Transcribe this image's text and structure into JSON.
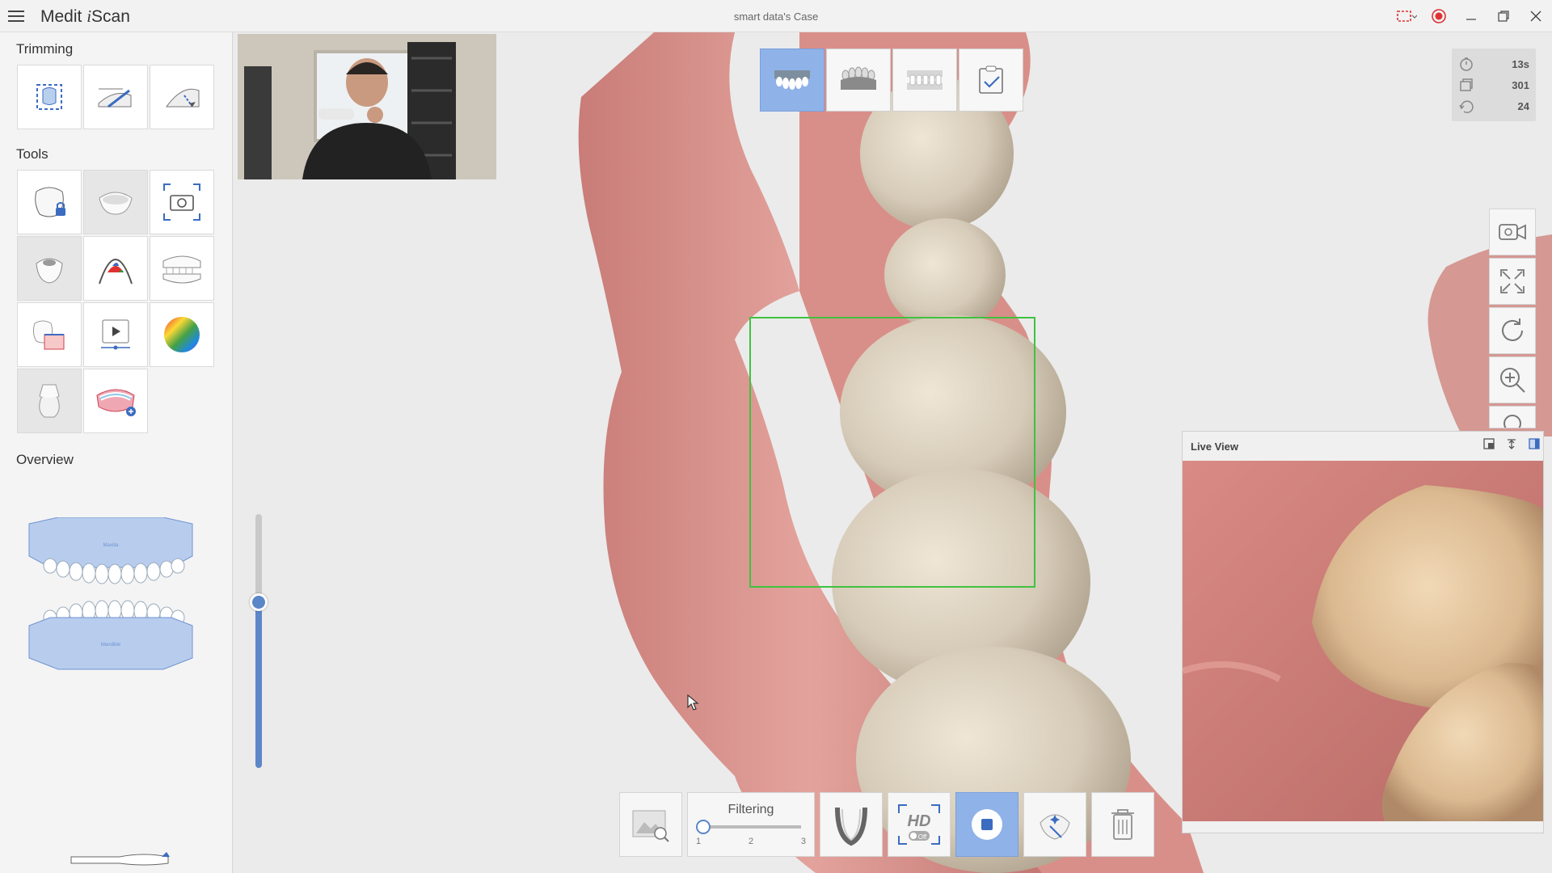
{
  "app": {
    "title_prefix": "Medit ",
    "title_italic": "i",
    "title_suffix": "Scan",
    "case_title": "smart data's Case"
  },
  "left_panel": {
    "trimming_label": "Trimming",
    "tools_label": "Tools",
    "overview_label": "Overview",
    "overview_upper_text": "Maxilla",
    "overview_lower_text": "Mandible"
  },
  "stats": {
    "time": "13s",
    "frames": "301",
    "rotation": "24"
  },
  "live_view": {
    "title": "Live View"
  },
  "filtering": {
    "label": "Filtering",
    "ticks": [
      "1",
      "2",
      "3"
    ],
    "value": 1
  },
  "hd": {
    "label": "HD",
    "state": "Off"
  },
  "colors": {
    "accent": "#8fb2e8",
    "accent_dark": "#5b86c7",
    "selection_box": "#3fc23f"
  }
}
